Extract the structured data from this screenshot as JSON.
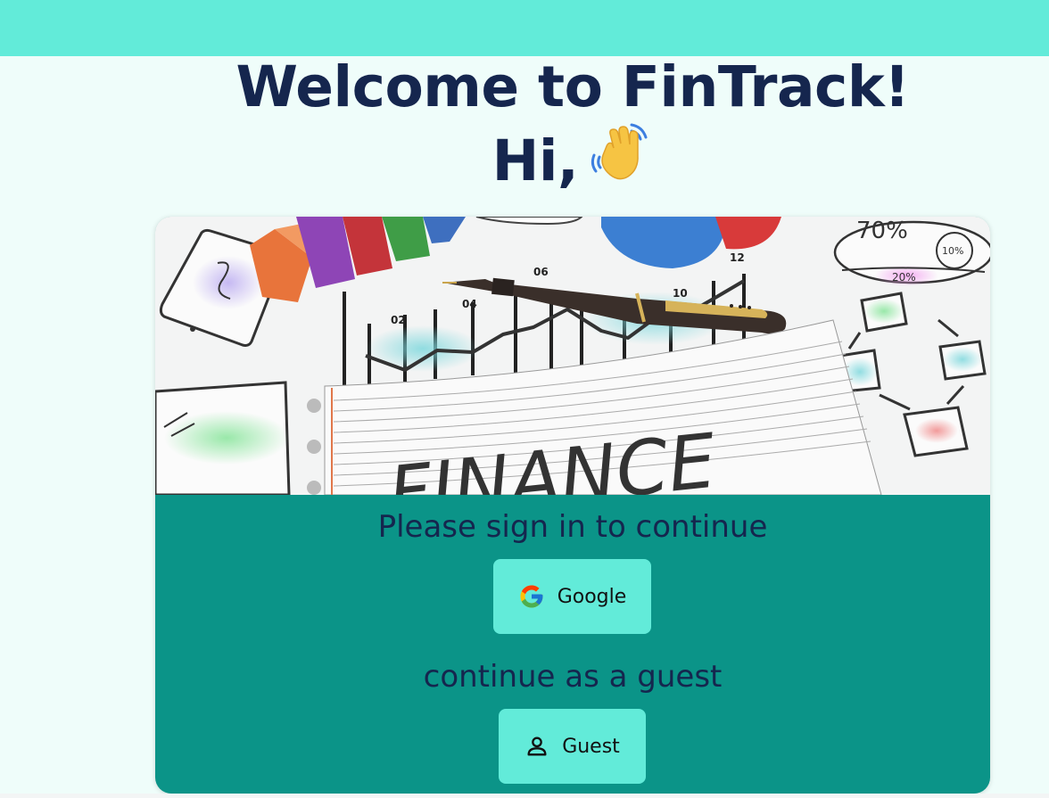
{
  "header": {
    "title": "Welcome to FinTrack!",
    "greeting": "Hi,"
  },
  "hero": {
    "word": "FINANCE",
    "labels": [
      "02",
      "04",
      "06",
      "10",
      "12",
      "70%",
      "10%",
      "20%"
    ]
  },
  "signin": {
    "prompt": "Please sign in to continue",
    "google_label": "Google"
  },
  "guest": {
    "prompt": "continue as a guest",
    "guest_label": "Guest"
  },
  "icons": {
    "wave": "waving-hand-icon",
    "google": "google-logo-icon",
    "guest": "person-icon"
  },
  "colors": {
    "topbar": "#62ebd9",
    "background": "#effdfa",
    "heading": "#15264e",
    "card_panel": "#0b9488",
    "button": "#62ebd9"
  }
}
